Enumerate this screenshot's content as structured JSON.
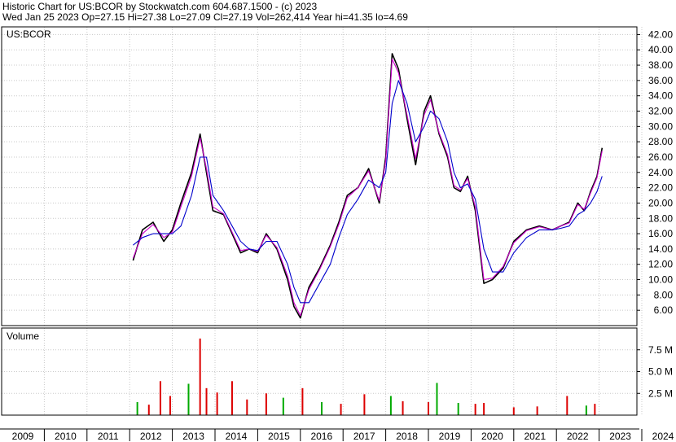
{
  "header": {
    "line1": "Historic Chart for US:BCOR by Stockwatch.com 604.687.1500 - (c) 2023",
    "line2": "Wed Jan 25 2023   Op=27.15   Hi=27.38   Lo=27.09   Cl=27.19   Vol=262,414   Year hi=41.35   lo=4.69"
  },
  "chart_data": [
    {
      "type": "line",
      "title": "US:BCOR",
      "ylim": [
        4,
        43
      ],
      "yticks": [
        6,
        8,
        10,
        12,
        14,
        16,
        18,
        20,
        22,
        24,
        26,
        28,
        30,
        32,
        34,
        36,
        38,
        40,
        42
      ],
      "ytick_labels": [
        "6.00",
        "8.00",
        "10.00",
        "12.00",
        "14.00",
        "16.00",
        "18.00",
        "20.00",
        "22.00",
        "24.00",
        "26.00",
        "28.00",
        "30.00",
        "32.00",
        "34.00",
        "36.00",
        "38.00",
        "40.00",
        "42.00"
      ],
      "x": [
        2012.08,
        2012.3,
        2012.55,
        2012.8,
        2013.0,
        2013.2,
        2013.45,
        2013.65,
        2013.8,
        2013.95,
        2014.2,
        2014.4,
        2014.6,
        2014.8,
        2015.0,
        2015.2,
        2015.45,
        2015.7,
        2015.85,
        2016.0,
        2016.2,
        2016.45,
        2016.7,
        2016.9,
        2017.1,
        2017.35,
        2017.6,
        2017.85,
        2018.0,
        2018.15,
        2018.3,
        2018.5,
        2018.7,
        2018.9,
        2019.05,
        2019.25,
        2019.45,
        2019.6,
        2019.75,
        2019.92,
        2020.1,
        2020.3,
        2020.5,
        2020.75,
        2021.0,
        2021.3,
        2021.6,
        2021.9,
        2022.1,
        2022.3,
        2022.5,
        2022.65,
        2022.8,
        2022.95,
        2023.07
      ],
      "series": [
        {
          "color": "#000000",
          "values": [
            12.5,
            16.5,
            17.5,
            15.0,
            16.5,
            20.0,
            24.0,
            29.0,
            24.0,
            19.0,
            18.5,
            16.0,
            13.5,
            14.0,
            13.5,
            16.0,
            14.0,
            10.0,
            6.5,
            5.0,
            9.0,
            11.5,
            14.5,
            17.5,
            21.0,
            22.0,
            24.5,
            20.0,
            26.0,
            39.5,
            37.5,
            31.0,
            25.0,
            32.0,
            34.0,
            29.0,
            26.0,
            22.0,
            21.5,
            23.5,
            19.0,
            9.5,
            10.0,
            11.5,
            15.0,
            16.5,
            17.0,
            16.5,
            17.0,
            17.5,
            20.0,
            19.0,
            21.5,
            23.5,
            27.2
          ]
        },
        {
          "color": "#cc00cc",
          "values": [
            12.8,
            16.0,
            17.2,
            15.5,
            16.2,
            19.5,
            23.5,
            28.5,
            24.5,
            19.5,
            18.6,
            16.2,
            13.8,
            14.0,
            13.7,
            15.8,
            14.2,
            10.5,
            7.0,
            5.3,
            8.7,
            11.3,
            14.3,
            17.2,
            20.7,
            22.0,
            24.2,
            20.3,
            25.5,
            38.8,
            37.0,
            31.5,
            25.8,
            31.5,
            33.5,
            29.2,
            26.3,
            22.3,
            21.7,
            23.2,
            19.5,
            10.0,
            10.2,
            11.7,
            14.8,
            16.4,
            16.9,
            16.5,
            17.0,
            17.4,
            19.8,
            19.2,
            21.3,
            23.3,
            26.8
          ]
        },
        {
          "color": "#0000cc",
          "values": [
            14.5,
            15.5,
            16.0,
            16.0,
            16.0,
            17.0,
            21.0,
            26.0,
            26.0,
            21.0,
            19.0,
            17.0,
            15.0,
            14.0,
            13.8,
            15.0,
            15.0,
            12.0,
            9.0,
            7.0,
            7.0,
            9.5,
            12.0,
            15.5,
            18.5,
            20.5,
            23.0,
            22.0,
            24.0,
            33.0,
            36.0,
            33.0,
            28.0,
            30.0,
            32.0,
            31.0,
            28.0,
            24.0,
            22.0,
            22.5,
            20.5,
            14.0,
            11.0,
            11.0,
            13.5,
            15.5,
            16.5,
            16.5,
            16.7,
            17.0,
            18.5,
            19.0,
            20.0,
            21.5,
            23.5
          ]
        }
      ]
    },
    {
      "type": "bar",
      "title": "Volume",
      "ylim": [
        0,
        10
      ],
      "yticks": [
        2.5,
        5.0,
        7.5
      ],
      "ytick_labels": [
        "2.5 M",
        "5.0 M",
        "7.5 M"
      ],
      "spikes": [
        {
          "x": 2012.18,
          "value": 1.5,
          "color": "#00aa00"
        },
        {
          "x": 2012.45,
          "value": 1.2,
          "color": "#dd0000"
        },
        {
          "x": 2012.72,
          "value": 3.9,
          "color": "#dd0000"
        },
        {
          "x": 2012.95,
          "value": 2.2,
          "color": "#dd0000"
        },
        {
          "x": 2013.38,
          "value": 3.6,
          "color": "#00aa00"
        },
        {
          "x": 2013.65,
          "value": 8.8,
          "color": "#dd0000"
        },
        {
          "x": 2013.8,
          "value": 3.1,
          "color": "#dd0000"
        },
        {
          "x": 2014.05,
          "value": 2.6,
          "color": "#dd0000"
        },
        {
          "x": 2014.4,
          "value": 3.9,
          "color": "#dd0000"
        },
        {
          "x": 2014.75,
          "value": 1.8,
          "color": "#dd0000"
        },
        {
          "x": 2015.2,
          "value": 2.5,
          "color": "#dd0000"
        },
        {
          "x": 2015.6,
          "value": 2.0,
          "color": "#00aa00"
        },
        {
          "x": 2016.05,
          "value": 3.1,
          "color": "#dd0000"
        },
        {
          "x": 2016.5,
          "value": 1.5,
          "color": "#00aa00"
        },
        {
          "x": 2016.95,
          "value": 1.3,
          "color": "#dd0000"
        },
        {
          "x": 2017.5,
          "value": 2.4,
          "color": "#dd0000"
        },
        {
          "x": 2018.12,
          "value": 2.2,
          "color": "#00aa00"
        },
        {
          "x": 2018.4,
          "value": 1.6,
          "color": "#dd0000"
        },
        {
          "x": 2019.0,
          "value": 1.5,
          "color": "#dd0000"
        },
        {
          "x": 2019.2,
          "value": 3.7,
          "color": "#00aa00"
        },
        {
          "x": 2019.7,
          "value": 1.4,
          "color": "#00aa00"
        },
        {
          "x": 2020.1,
          "value": 1.3,
          "color": "#dd0000"
        },
        {
          "x": 2020.3,
          "value": 1.4,
          "color": "#dd0000"
        },
        {
          "x": 2021.0,
          "value": 0.9,
          "color": "#dd0000"
        },
        {
          "x": 2021.55,
          "value": 1.0,
          "color": "#dd0000"
        },
        {
          "x": 2022.25,
          "value": 2.2,
          "color": "#dd0000"
        },
        {
          "x": 2022.7,
          "value": 1.1,
          "color": "#00aa00"
        },
        {
          "x": 2022.9,
          "value": 1.3,
          "color": "#dd0000"
        }
      ]
    }
  ],
  "x_axis": {
    "ticks": [
      2009,
      2010,
      2011,
      2012,
      2013,
      2014,
      2015,
      2016,
      2017,
      2018,
      2019,
      2020,
      2021,
      2022,
      2023,
      2024
    ],
    "labels": [
      "2009",
      "2010",
      "2011",
      "2012",
      "2013",
      "2014",
      "2015",
      "2016",
      "2017",
      "2018",
      "2019",
      "2020",
      "2021",
      "2022",
      "2023",
      "2024"
    ]
  }
}
